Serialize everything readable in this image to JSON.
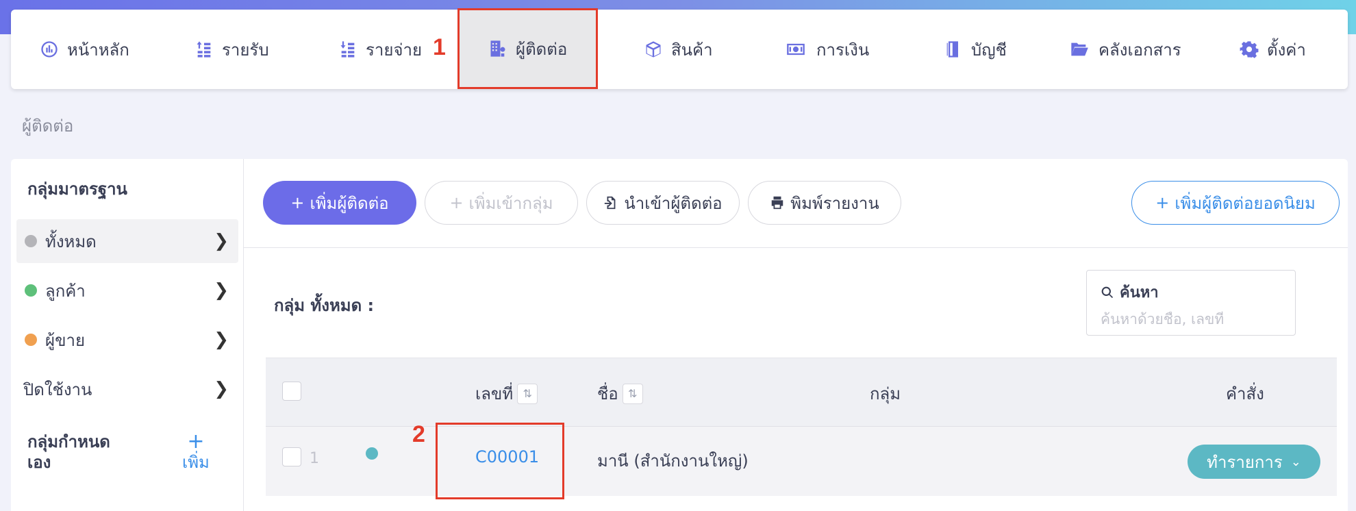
{
  "nav": {
    "items": [
      {
        "label": "หน้าหลัก",
        "icon": "dashboard-icon"
      },
      {
        "label": "รายรับ",
        "icon": "income-icon"
      },
      {
        "label": "รายจ่าย",
        "icon": "expense-icon"
      },
      {
        "label": "ผู้ติดต่อ",
        "icon": "contacts-icon"
      },
      {
        "label": "สินค้า",
        "icon": "box-icon"
      },
      {
        "label": "การเงิน",
        "icon": "money-icon"
      },
      {
        "label": "บัญชี",
        "icon": "ledger-icon"
      },
      {
        "label": "คลังเอกสาร",
        "icon": "folder-icon"
      },
      {
        "label": "ตั้งค่า",
        "icon": "gear-icon"
      }
    ],
    "active": "ผู้ติดต่อ"
  },
  "annotations": {
    "step1": "1",
    "step2": "2"
  },
  "breadcrumb": "ผู้ติดต่อ",
  "sidebar": {
    "title": "กลุ่มมาตรฐาน",
    "items": [
      {
        "label": "ทั้งหมด",
        "dot_color": "#b4b4b8"
      },
      {
        "label": "ลูกค้า",
        "dot_color": "#5ec07a"
      },
      {
        "label": "ผู้ขาย",
        "dot_color": "#f0a050"
      },
      {
        "label": "ปิดใช้งาน",
        "dot_color": ""
      }
    ],
    "custom_title": "กลุ่มกำหนดเอง",
    "custom_title_line1": "กลุ่มกำหนด",
    "custom_title_line2": "เอง",
    "add_plus": "+",
    "add_label": "เพิ่ม"
  },
  "toolbar": {
    "add_contact": "เพิ่มผู้ติดต่อ",
    "add_to_group": "เพิ่มเข้ากลุ่ม",
    "import_contacts": "นำเข้าผู้ติดต่อ",
    "print_report": "พิมพ์รายงาน",
    "add_popular": "เพิ่มผู้ติดต่อยอดนิยม"
  },
  "group_heading": "กลุ่ม ทั้งหมด :",
  "search": {
    "label": "ค้นหา",
    "placeholder": "ค้นหาด้วยชื่อ, เลขที่"
  },
  "table": {
    "headers": {
      "number": "เลขที่",
      "name": "ชื่อ",
      "group": "กลุ่ม",
      "command": "คำสั่ง"
    },
    "rows": [
      {
        "index": "1",
        "dot_color": "#5cb8c4",
        "code": "C00001",
        "name": "มานี (สำนักงานใหญ่)",
        "group": "",
        "action": "ทำรายการ"
      }
    ]
  },
  "colors": {
    "accent": "#6c6ce8",
    "link": "#3a8ee8",
    "annotation": "#e33b2a",
    "action": "#5cb8c4"
  }
}
